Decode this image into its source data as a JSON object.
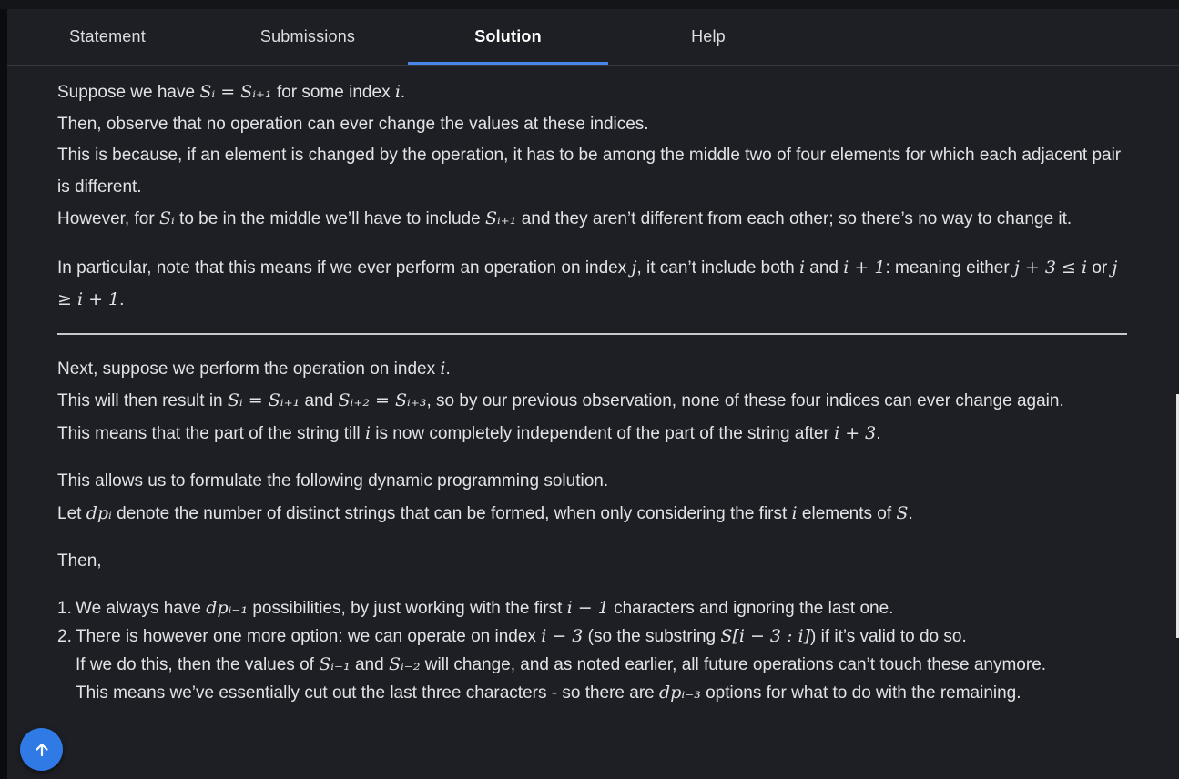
{
  "tabs": [
    {
      "label": "Statement"
    },
    {
      "label": "Submissions"
    },
    {
      "label": "Solution"
    },
    {
      "label": "Help"
    }
  ],
  "solution": {
    "p1": {
      "pre": "Suppose we have ",
      "math1": "Sᵢ = Sᵢ₊₁",
      "mid": " for some index ",
      "math2": "i",
      "post": "."
    },
    "p2": "Then, observe that no operation can ever change the values at these indices.",
    "p3": "This is because, if an element is changed by the operation, it has to be among the middle two of four elements for which each adjacent pair is different.",
    "p4": {
      "pre": "However, for ",
      "math1": "Sᵢ",
      "mid": " to be in the middle we’ll have to include ",
      "math2": "Sᵢ₊₁",
      "post": " and they aren’t different from each other; so there’s no way to change it."
    },
    "p5": {
      "pre": "In particular, note that this means if we ever perform an operation on index ",
      "m1": "j",
      "t1": ", it can’t include both ",
      "m2": "i",
      "t2": " and ",
      "m3": "i + 1",
      "t3": ": meaning either ",
      "m4": "j + 3 ≤ i",
      "t4": " or ",
      "m5": "j ≥ i + 1",
      "t5": "."
    },
    "p6": {
      "pre": "Next, suppose we perform the operation on index ",
      "m1": "i",
      "post": "."
    },
    "p7": {
      "pre": "This will then result in ",
      "m1": "Sᵢ = Sᵢ₊₁",
      "t1": " and ",
      "m2": "Sᵢ₊₂ = Sᵢ₊₃",
      "post": ", so by our previous observation, none of these four indices can ever change again."
    },
    "p8": {
      "pre": "This means that the part of the string till ",
      "m1": "i",
      "t1": " is now completely independent of the part of the string after ",
      "m2": "i + 3",
      "post": "."
    },
    "p9": "This allows us to formulate the following dynamic programming solution.",
    "p10": {
      "pre": "Let ",
      "m1": "dpᵢ",
      "t1": " denote the number of distinct strings that can be formed, when only considering the first ",
      "m2": "i",
      "t2": " elements of ",
      "m3": "S",
      "post": "."
    },
    "p11": "Then,",
    "li1": {
      "num": "1.",
      "pre": "We always have ",
      "m1": "dpᵢ₋₁",
      "t1": " possibilities, by just working with the first ",
      "m2": "i − 1",
      "post": " characters and ignoring the last one."
    },
    "li2": {
      "num": "2.",
      "pre": "There is however one more option: we can operate on index ",
      "m1": "i − 3",
      "t1": " (so the substring ",
      "m2": "S[i − 3 : i]",
      "post": ") if it’s valid to do so."
    },
    "li2b": {
      "pre": "If we do this, then the values of ",
      "m1": "Sᵢ₋₁",
      "t1": " and ",
      "m2": "Sᵢ₋₂",
      "post": " will change, and as noted earlier, all future operations can’t touch these anymore."
    },
    "li2c": {
      "pre": "This means we’ve essentially cut out the last three characters - so there are ",
      "m1": "dpᵢ₋₃",
      "post": " options for what to do with the remaining."
    }
  },
  "scroll_top_icon": "arrow-up-icon"
}
